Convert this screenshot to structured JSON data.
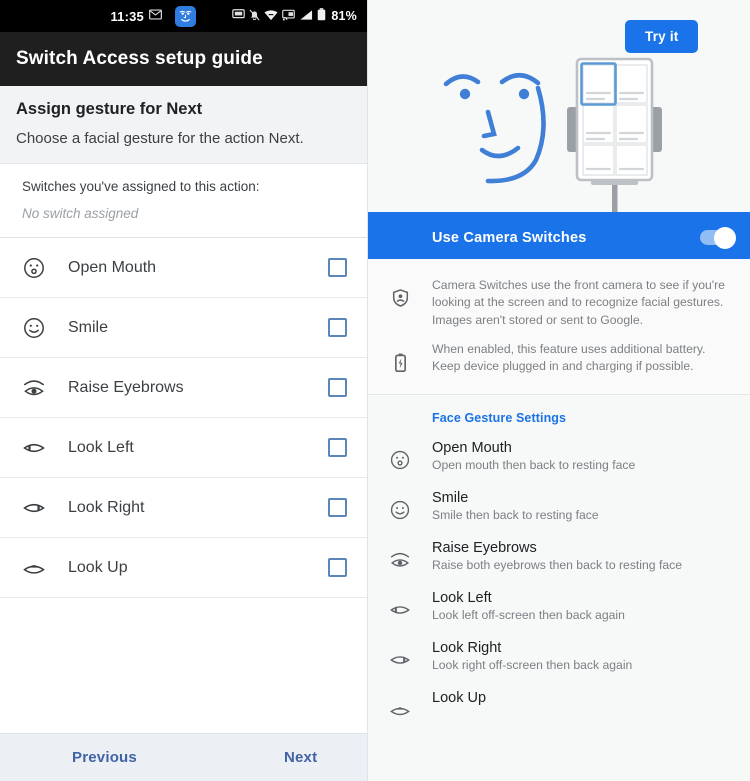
{
  "left": {
    "statusbar": {
      "time": "11:35",
      "battery_pct": "81%",
      "icons": [
        "envelope-icon",
        "app-face-icon",
        "screenshot-icon",
        "bell-muted-icon",
        "wifi-icon",
        "cast-icon",
        "signal-icon",
        "battery-icon"
      ]
    },
    "appbar": {
      "title": "Switch Access setup guide"
    },
    "assign": {
      "title": "Assign gesture for Next",
      "subtitle": "Choose a facial gesture for the action Next."
    },
    "assigned": {
      "label": "Switches you've assigned to this action:",
      "value": "No switch assigned"
    },
    "gestures": [
      {
        "label": "Open Mouth",
        "icon": "open-mouth-face-icon",
        "checked": false
      },
      {
        "label": "Smile",
        "icon": "smile-face-icon",
        "checked": false
      },
      {
        "label": "Raise Eyebrows",
        "icon": "raise-eyebrows-eye-icon",
        "checked": false
      },
      {
        "label": "Look Left",
        "icon": "look-left-eye-icon",
        "checked": false
      },
      {
        "label": "Look Right",
        "icon": "look-right-eye-icon",
        "checked": false
      },
      {
        "label": "Look Up",
        "icon": "look-up-eye-icon",
        "checked": false
      }
    ],
    "nav": {
      "previous": "Previous",
      "next": "Next"
    }
  },
  "right": {
    "hero": {
      "try_button": "Try it",
      "illustration": "face-and-phone-on-stand-illustration"
    },
    "toggle": {
      "label": "Use Camera Switches",
      "state": "on"
    },
    "info": [
      {
        "icon": "privacy-shield-icon",
        "text": "Camera Switches use the front camera to see if you're looking at the screen and to recognize facial gestures. Images aren't stored or sent to Google."
      },
      {
        "icon": "battery-charging-icon",
        "text": "When enabled, this feature uses additional battery. Keep device plugged in and charging if possible."
      }
    ],
    "face_gesture_settings": {
      "title": "Face Gesture Settings",
      "items": [
        {
          "name": "Open Mouth",
          "desc": "Open mouth then back to resting face",
          "icon": "open-mouth-face-icon"
        },
        {
          "name": "Smile",
          "desc": "Smile then back to resting face",
          "icon": "smile-face-icon"
        },
        {
          "name": "Raise Eyebrows",
          "desc": "Raise both eyebrows then back to resting face",
          "icon": "raise-eyebrows-eye-icon"
        },
        {
          "name": "Look Left",
          "desc": "Look left off-screen then back again",
          "icon": "look-left-eye-icon"
        },
        {
          "name": "Look Right",
          "desc": "Look right off-screen then back again",
          "icon": "look-right-eye-icon"
        },
        {
          "name": "Look Up",
          "desc": "",
          "icon": "look-up-eye-icon"
        }
      ]
    }
  },
  "colors": {
    "accent_blue": "#1a73e8",
    "statusbar_black": "#000000",
    "appbar_dark": "#1f1f1f",
    "checkbox_blue": "#5b86ba",
    "nav_link_blue": "#3f63a4",
    "muted_gray": "#7c8084"
  }
}
